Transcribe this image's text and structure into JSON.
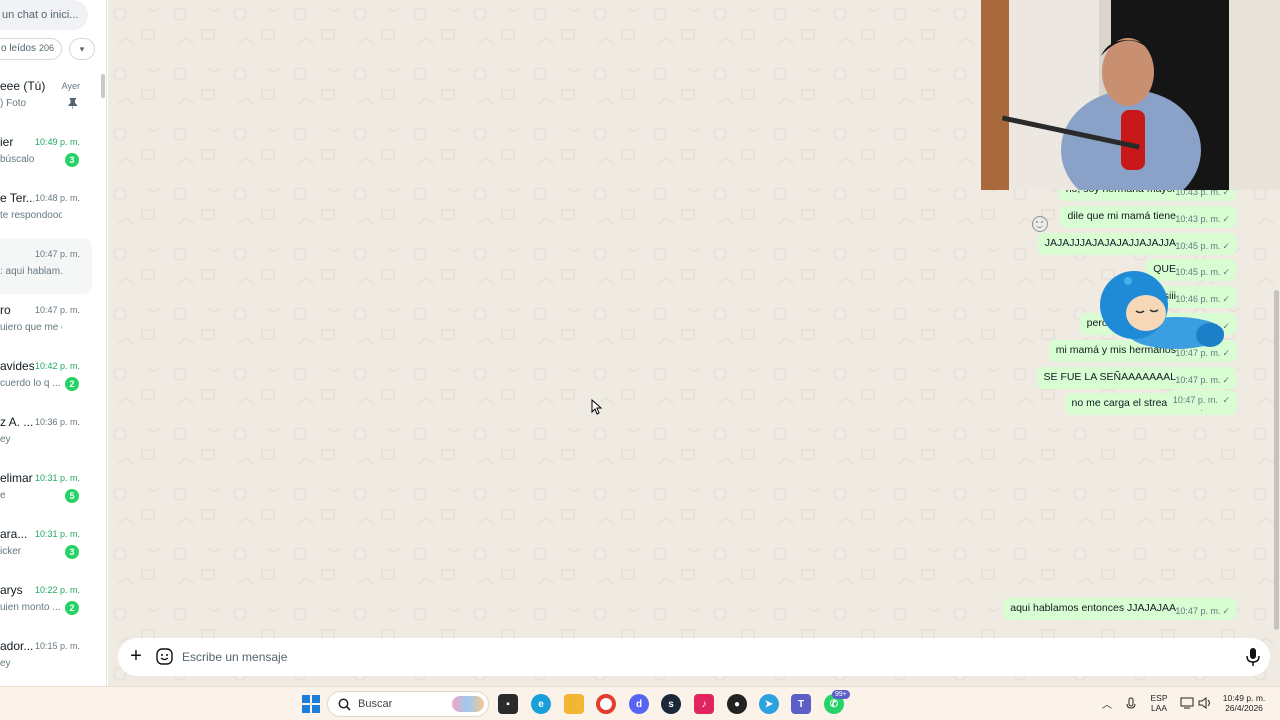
{
  "sidebar": {
    "search_placeholder": "un chat o inici...",
    "filter_label": "o leídos",
    "filter_count": "206",
    "chats": [
      {
        "name": "eee (Tú)",
        "time": "Ayer",
        "preview": ") Foto",
        "badge": "",
        "pinned": true,
        "unread": false
      },
      {
        "name": "ier",
        "time": "10:49 p. m.",
        "preview": "búscalo",
        "badge": "3",
        "pinned": false,
        "unread": true
      },
      {
        "name": "e Ter...",
        "time": "10:48 p. m.",
        "preview": "te respondooo",
        "badge": "",
        "pinned": false,
        "unread": false
      },
      {
        "name": "",
        "time": "10:47 p. m.",
        "preview": ": aqui hablam...",
        "badge": "",
        "pinned": false,
        "unread": false
      },
      {
        "name": "ro",
        "time": "10:47 p. m.",
        "preview": "uiero que me d...",
        "badge": "",
        "pinned": false,
        "unread": false
      },
      {
        "name": "avides",
        "time": "10:42 p. m.",
        "preview": "cuerdo lo q ...",
        "badge": "2",
        "pinned": false,
        "unread": true
      },
      {
        "name": "z A. ...",
        "time": "10:36 p. m.",
        "preview": "ey",
        "badge": "",
        "pinned": false,
        "unread": false
      },
      {
        "name": "elimar",
        "time": "10:31 p. m.",
        "preview": "e",
        "badge": "5",
        "pinned": false,
        "unread": true
      },
      {
        "name": "ara...",
        "time": "10:31 p. m.",
        "preview": "icker",
        "badge": "3",
        "pinned": false,
        "unread": true
      },
      {
        "name": "arys",
        "time": "10:22 p. m.",
        "preview": "uien monto ...",
        "badge": "2",
        "pinned": false,
        "unread": true
      },
      {
        "name": "ador...",
        "time": "10:15 p. m.",
        "preview": "ey",
        "badge": "",
        "pinned": false,
        "unread": false
      }
    ]
  },
  "messages": [
    {
      "text": "no, soy hermana mayor",
      "time": "10:43 p. m."
    },
    {
      "text": "dile que mi mamá tiene",
      "time": "10:43 p. m."
    },
    {
      "text": "JAJAJJJAJAJAJAJJAJAJJA",
      "time": "10:45 p. m."
    },
    {
      "text": "QUE",
      "time": "10:45 p. m."
    },
    {
      "text": "siii",
      "time": "10:46 p. m."
    },
    {
      "text": "pero no hay luuuuz",
      "time": "10:46 p. m."
    },
    {
      "text": "mi mamá y mis hermanos",
      "time": "10:47 p. m."
    },
    {
      "text": "SE FUE LA SEÑAAAAAAAL",
      "time": "10:47 p. m."
    },
    {
      "text": "no me carga el stream",
      "time": "10:47 p. m."
    }
  ],
  "sticker_time": "10:47 p. m.",
  "last_message": {
    "text": "aqui hablamos entonces JJAJAJAA",
    "time": "10:47 p. m."
  },
  "composer": {
    "placeholder": "Escribe un mensaje"
  },
  "taskbar": {
    "search_label": "Buscar",
    "notif_badge": "99+",
    "lang_top": "ESP",
    "lang_bottom": "LAA",
    "clock_time": "10:49 p. m.",
    "clock_date": "26/4/2026"
  },
  "colors": {
    "bubble_out": "#d9fdd3",
    "chat_bg": "#efeae2",
    "accent_green": "#25d366",
    "unread_time": "#1daa61"
  }
}
